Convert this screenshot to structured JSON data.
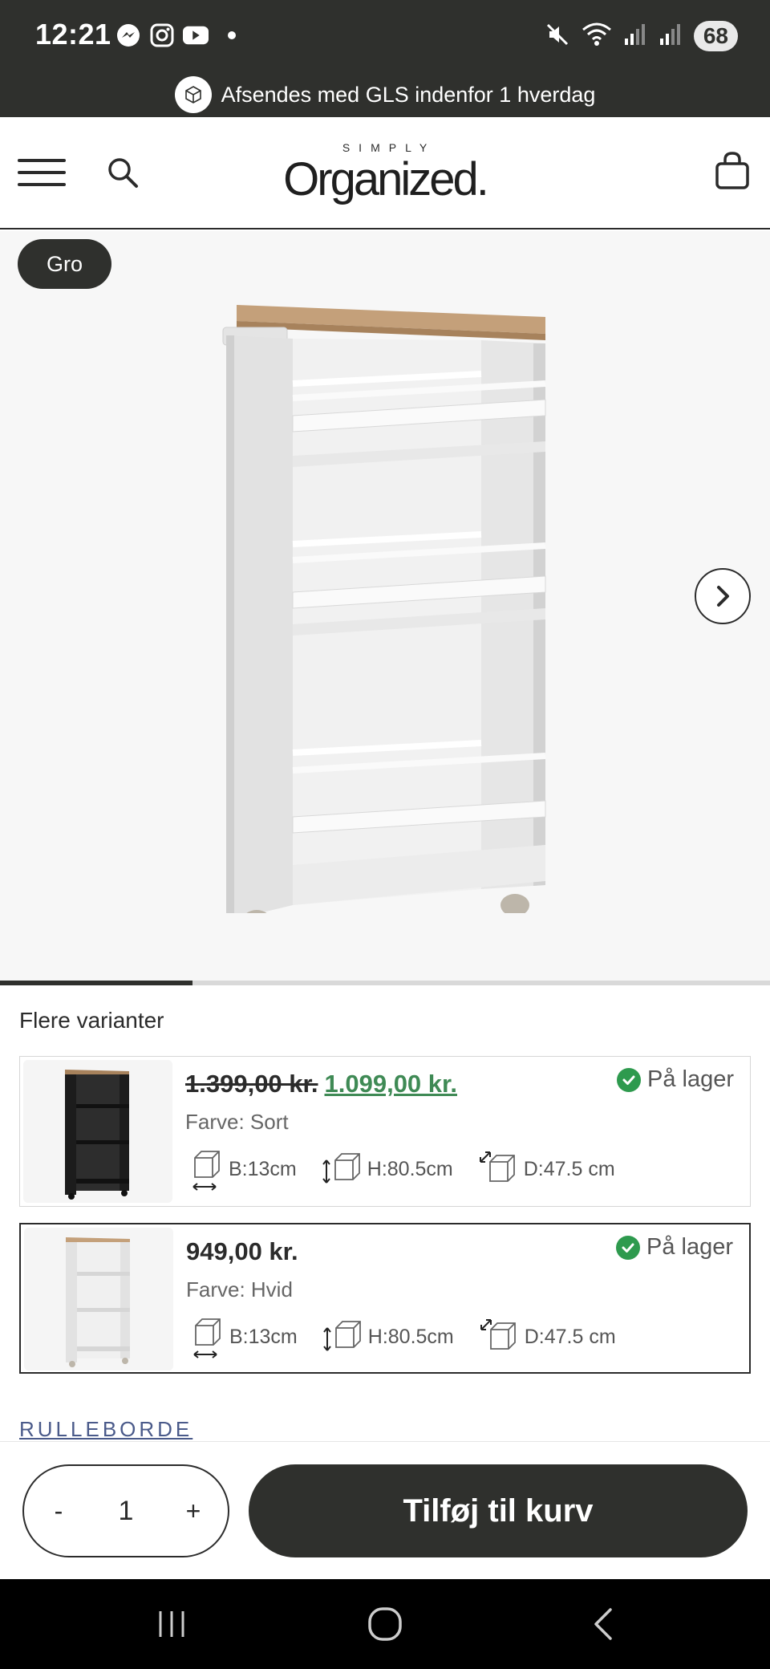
{
  "status_bar": {
    "time": "12:21",
    "battery": "68",
    "icons_left": [
      "messenger-icon",
      "instagram-icon",
      "youtube-icon",
      "dot"
    ],
    "icons_right": [
      "mute-icon",
      "wifi-icon",
      "signal-icon",
      "signal-icon"
    ]
  },
  "announcement": {
    "text": "Afsendes med GLS indenfor 1 hverdag"
  },
  "header": {
    "logo_small": "SIMPLY",
    "logo_big": "Organized."
  },
  "gallery": {
    "tag": "Gro",
    "progress_fraction": 0.25
  },
  "variants": {
    "title": "Flere varianter",
    "items": [
      {
        "old_price": "1.399,00 kr.",
        "price": "1.099,00 kr.",
        "stock": "På lager",
        "color": "Farve: Sort",
        "width": "B:13cm",
        "height": "H:80.5cm",
        "depth": "D:47.5 cm",
        "swatch": "#1c1c1c"
      },
      {
        "old_price": "",
        "price": "949,00 kr.",
        "stock": "På lager",
        "color": "Farve: Hvid",
        "width": "B:13cm",
        "height": "H:80.5cm",
        "depth": "D:47.5 cm",
        "swatch": "#e8e8e8"
      }
    ]
  },
  "category_link": "RULLEBORDE",
  "cart": {
    "qty_minus": "-",
    "qty_value": "1",
    "qty_plus": "+",
    "add_label": "Tilføj til kurv"
  },
  "colors": {
    "dark": "#2f302d",
    "sale_green": "#3f8a55",
    "stock_green": "#2e9a4e",
    "link_blue": "#4a5a8a"
  }
}
